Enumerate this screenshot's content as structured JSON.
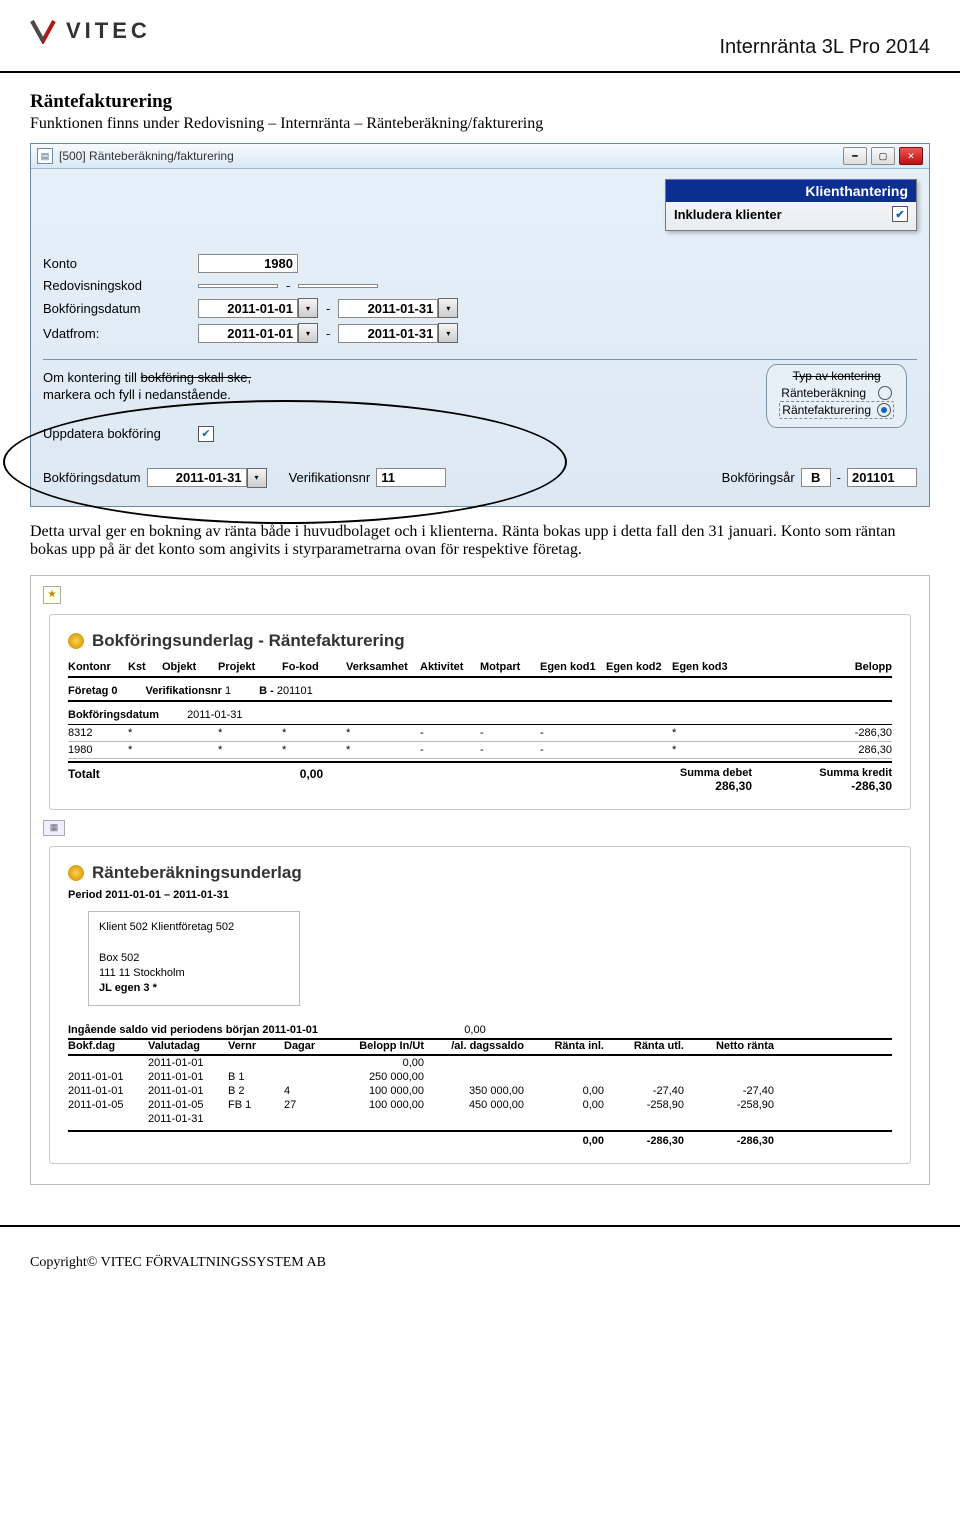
{
  "header": {
    "brand": "VITEC",
    "doc_title": "Internränta 3L Pro 2014"
  },
  "section1": {
    "title": "Räntefakturering",
    "intro": "Funktionen finns under Redovisning – Internränta – Ränteberäkning/fakturering"
  },
  "dialog": {
    "window_title": "[500] Ränteberäkning/fakturering",
    "klient_header": "Klienthantering",
    "klient_label": "Inkludera klienter",
    "klient_checked": true,
    "fields": {
      "konto_label": "Konto",
      "konto_value": "1980",
      "redov_label": "Redovisningskod",
      "bokdat_label": "Bokföringsdatum",
      "bokdat_from": "2011-01-01",
      "bokdat_to": "2011-01-31",
      "vdat_label": "Vdatfrom:",
      "vdat_from": "2011-01-01",
      "vdat_to": "2011-01-31"
    },
    "booking": {
      "text1_pre": "Om kontering till ",
      "text1_strike": "bokföring skall ske,",
      "text2": "markera och fyll i nedanstående.",
      "uppd_label": "Uppdatera bokföring",
      "uppd_checked": true,
      "radio_group_title": "Typ av kontering",
      "radio1": "Ränteberäkning",
      "radio2": "Räntefakturering",
      "bokdat_label": "Bokföringsdatum",
      "bokdat_value": "2011-01-31",
      "ver_label": "Verifikationsnr",
      "ver_value": "11",
      "year_label": "Bokföringsår",
      "year_prefix": "B",
      "year_value": "201101"
    }
  },
  "paragraph": "Detta urval ger en bokning av ränta både i huvudbolaget och i klienterna. Ränta bokas upp i detta fall den 31 januari. Konto som räntan bokas upp på är det konto som angivits i styrparametrarna ovan för respektive företag.",
  "report1": {
    "title": "Bokföringsunderlag - Räntefakturering",
    "columns": [
      "Kontonr",
      "Kst",
      "Objekt",
      "Projekt",
      "Fo-kod",
      "Verksamhet",
      "Aktivitet",
      "Motpart",
      "Egen kod1",
      "Egen kod2",
      "Egen kod3",
      "Belopp"
    ],
    "sub": {
      "foretag_label": "Företag 0",
      "ver_label": "Verifikationsnr",
      "ver_value": "1",
      "prefix": "B",
      "period": "201101"
    },
    "bokdat_label": "Bokföringsdatum",
    "bokdat_value": "2011-01-31",
    "rows": [
      {
        "konto": "8312",
        "kst": "*",
        "obj": "",
        "proj": "*",
        "fo": "*",
        "verk": "*",
        "akt": "-",
        "mot": "-",
        "e1": "-",
        "e2": "",
        "e3": "*",
        "belopp": "-286,30"
      },
      {
        "konto": "1980",
        "kst": "*",
        "obj": "",
        "proj": "*",
        "fo": "*",
        "verk": "*",
        "akt": "-",
        "mot": "-",
        "e1": "-",
        "e2": "",
        "e3": "*",
        "belopp": "286,30"
      }
    ],
    "totals": {
      "total_label": "Totalt",
      "total_value": "0,00",
      "debet_label": "Summa debet",
      "debet_value": "286,30",
      "kredit_label": "Summa kredit",
      "kredit_value": "-286,30"
    }
  },
  "report2": {
    "title": "Ränteberäkningsunderlag",
    "period_label": "Period 2011-01-01 – 2011-01-31",
    "client": {
      "id_line": "Klient    502   Klientföretag 502",
      "addr1": "Box 502",
      "addr2": "111 11 Stockholm",
      "extra": "JL egen 3        *"
    },
    "saldo_label": "Ingående saldo vid periodens början 2011-01-01",
    "saldo_value": "0,00",
    "cols": [
      "Bokf.dag",
      "Valutadag",
      "Vernr",
      "Dagar",
      "Belopp In/Ut",
      "/al. dagssaldo",
      "Ränta inl.",
      "Ränta utl.",
      "Netto ränta"
    ],
    "rows": [
      {
        "bd": "",
        "vd": "2011-01-01",
        "vn": "",
        "dg": "",
        "bel": "0,00",
        "ds": "",
        "ri": "",
        "ru": "",
        "nr": ""
      },
      {
        "bd": "2011-01-01",
        "vd": "2011-01-01",
        "vn": "B  1",
        "dg": "",
        "bel": "250 000,00",
        "ds": "",
        "ri": "",
        "ru": "",
        "nr": ""
      },
      {
        "bd": "2011-01-01",
        "vd": "2011-01-01",
        "vn": "B  2",
        "dg": "4",
        "bel": "100 000,00",
        "ds": "350 000,00",
        "ri": "0,00",
        "ru": "-27,40",
        "nr": "-27,40"
      },
      {
        "bd": "2011-01-05",
        "vd": "2011-01-05",
        "vn": "FB 1",
        "dg": "27",
        "bel": "100 000,00",
        "ds": "450 000,00",
        "ri": "0,00",
        "ru": "-258,90",
        "nr": "-258,90"
      },
      {
        "bd": "",
        "vd": "2011-01-31",
        "vn": "",
        "dg": "",
        "bel": "",
        "ds": "",
        "ri": "",
        "ru": "",
        "nr": ""
      }
    ],
    "totals": {
      "bel": "",
      "ds": "",
      "ri": "0,00",
      "ru": "-286,30",
      "nr": "-286,30"
    }
  },
  "footer": "Copyright© VITEC FÖRVALTNINGSSYSTEM AB"
}
